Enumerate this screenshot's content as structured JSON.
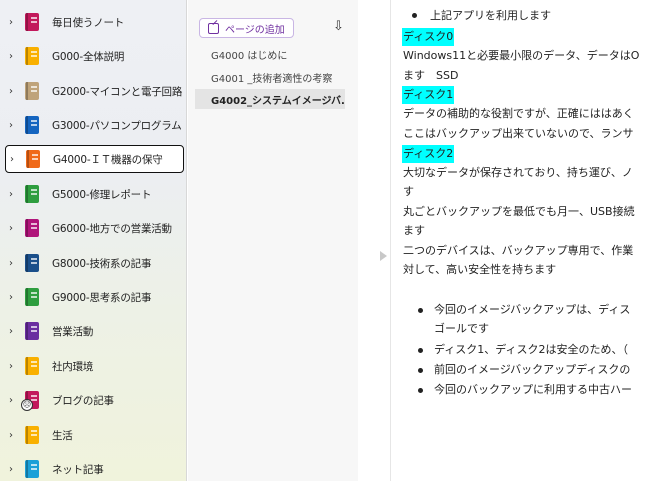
{
  "sections": [
    {
      "label": "毎日使うノート",
      "color": "#c2185b"
    },
    {
      "label": "G000-全体説明",
      "color": "#f9b000"
    },
    {
      "label": "G2000-マイコンと電子回路",
      "color": "#bfa37a"
    },
    {
      "label": "G3000-パソコンプログラム",
      "color": "#1565c0"
    },
    {
      "label": "G4000-ＩＴ機器の保守",
      "color": "#f06a1a",
      "active": true
    },
    {
      "label": "G5000-修理レポート",
      "color": "#2e9e3f"
    },
    {
      "label": "G6000-地方での営業活動",
      "color": "#b0157a"
    },
    {
      "label": "G8000-技術系の記事",
      "color": "#1a4f8a"
    },
    {
      "label": "G9000-思考系の記事",
      "color": "#2e9e3f"
    },
    {
      "label": "営業活動",
      "color": "#6a2ea0"
    },
    {
      "label": "社内環境",
      "color": "#f9b000"
    },
    {
      "label": "ブログの記事",
      "color": "#c2185b"
    },
    {
      "label": "生活",
      "color": "#f9b000"
    },
    {
      "label": "ネット記事",
      "color": "#1ba0d8"
    }
  ],
  "pages_pane": {
    "add_page_label": "ページの追加",
    "pages": [
      {
        "label": "G4000 はじめに"
      },
      {
        "label": "G4001 _技術者適性の考察"
      },
      {
        "label": "G4002_システムイメージバ...",
        "active": true
      }
    ]
  },
  "content": {
    "lines": [
      "上記アプリを利用します",
      "ディスク0",
      "Windows11と必要最小限のデータ、データはO",
      "ます　SSD",
      "ディスク1",
      "データの補助的な役割ですが、正確にははあく",
      "ここはバックアップ出来ていないので、ランサ",
      "ディスク2",
      "大切なデータが保存されており、持ち運び、ノ",
      "す",
      "丸ごとバックアップを最低でも月一、USB接続",
      "ます",
      "二つのデバイスは、バックアップ専用で、作業",
      "対して、高い安全性を持ちます",
      "今回のイメージバックアップは、ディス",
      "ゴールです",
      "ディスク1、ディスク2は安全のため、（",
      "前回のイメージバックアップディスクの",
      "今回のバックアップに利用する中古ハー"
    ]
  },
  "colors": {
    "highlight": "#00ffff",
    "accent": "#7030a0"
  }
}
